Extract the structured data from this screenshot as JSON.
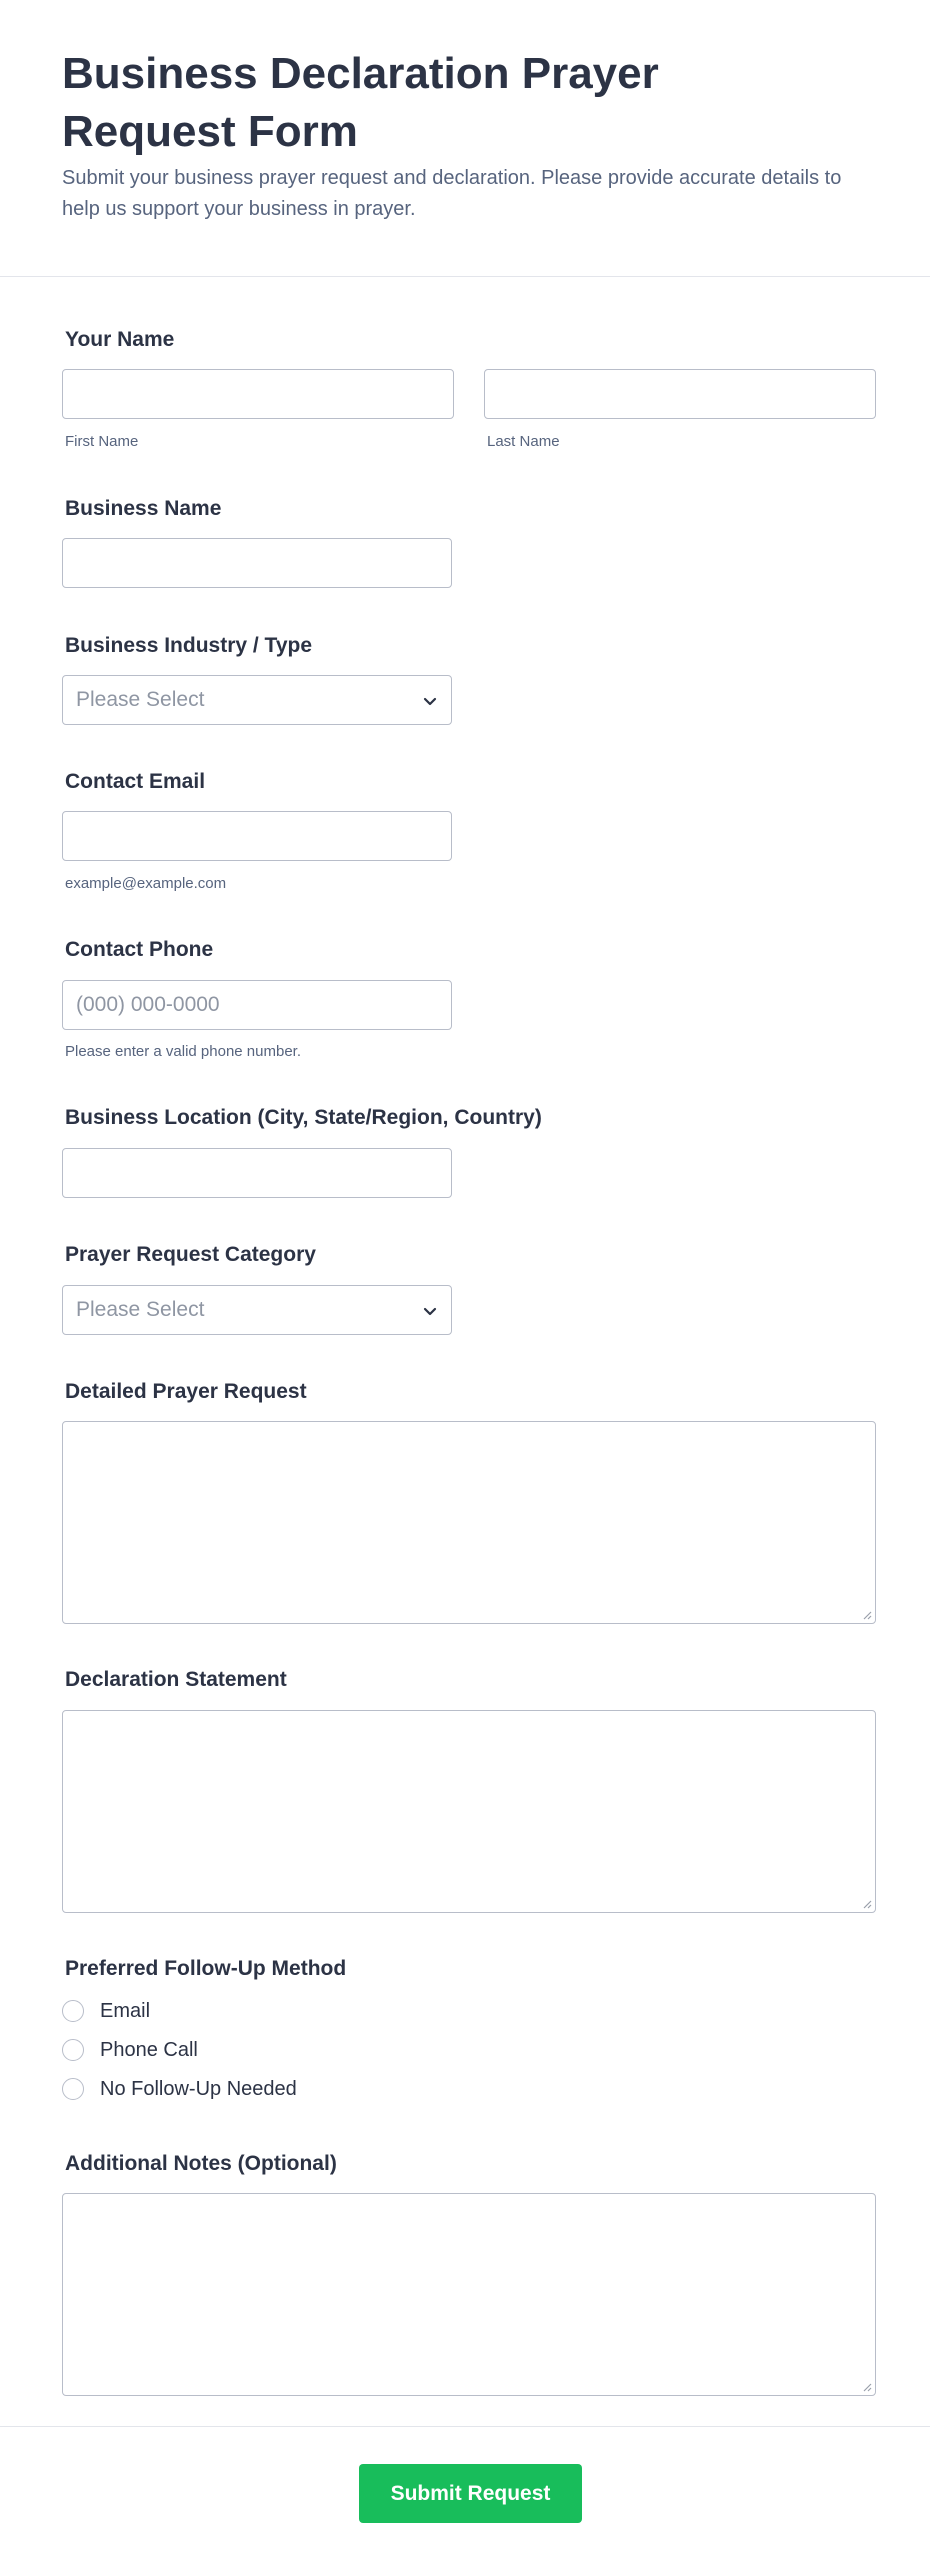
{
  "header": {
    "title": "Business Declaration Prayer Request Form",
    "subtitle": "Submit your business prayer request and declaration. Please provide accurate details to help us support your business in prayer."
  },
  "fields": {
    "your_name": {
      "label": "Your Name",
      "first_sublabel": "First Name",
      "last_sublabel": "Last Name",
      "first_value": "",
      "last_value": ""
    },
    "business_name": {
      "label": "Business Name",
      "value": ""
    },
    "industry": {
      "label": "Business Industry / Type",
      "selected": "Please Select"
    },
    "email": {
      "label": "Contact Email",
      "value": "",
      "sublabel": "example@example.com"
    },
    "phone": {
      "label": "Contact Phone",
      "placeholder": "(000) 000-0000",
      "sublabel": "Please enter a valid phone number."
    },
    "location": {
      "label": "Business Location (City, State/Region, Country)",
      "value": ""
    },
    "category": {
      "label": "Prayer Request Category",
      "selected": "Please Select"
    },
    "detailed_request": {
      "label": "Detailed Prayer Request",
      "value": ""
    },
    "declaration": {
      "label": "Declaration Statement",
      "value": ""
    },
    "follow_up": {
      "label": "Preferred Follow-Up Method",
      "options": [
        "Email",
        "Phone Call",
        "No Follow-Up Needed"
      ]
    },
    "notes": {
      "label": "Additional Notes (Optional)",
      "value": ""
    }
  },
  "submit": {
    "label": "Submit Request",
    "color": "#18bd5b"
  },
  "icons": {
    "select_arrow": "chevron-down-icon",
    "resize": "resize-grip-icon"
  }
}
